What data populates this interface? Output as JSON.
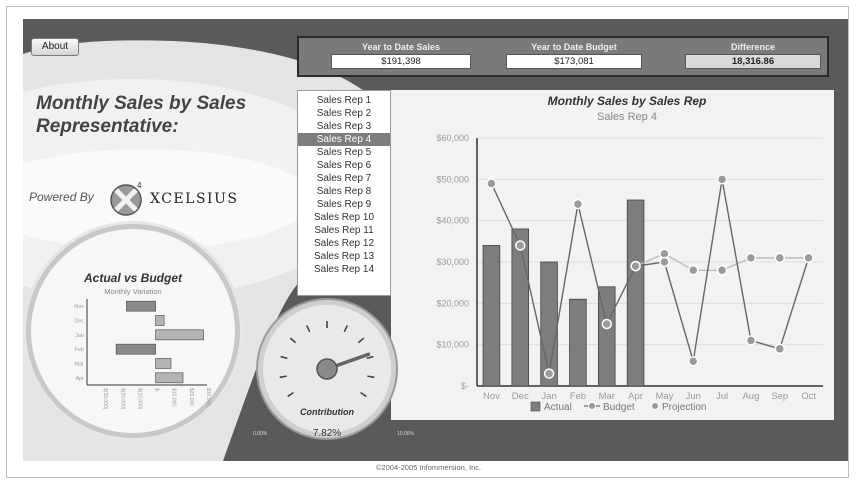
{
  "about_label": "About",
  "title": "Monthly Sales by Sales Representative:",
  "powered_by": "Powered By",
  "logo": {
    "superscript": "4",
    "text": "XCELSIUS",
    "icon": "xcelsius-logo-icon"
  },
  "kpis": [
    {
      "label": "Year to Date Sales",
      "value": "$191,398"
    },
    {
      "label": "Year to Date Budget",
      "value": "$173,081"
    },
    {
      "label": "Difference",
      "value": "18,316.86"
    }
  ],
  "reps": [
    "Sales Rep 1",
    "Sales Rep 2",
    "Sales Rep 3",
    "Sales Rep 4",
    "Sales Rep 5",
    "Sales Rep 6",
    "Sales Rep 7",
    "Sales Rep 8",
    "Sales Rep 9",
    "Sales Rep 10",
    "Sales Rep 11",
    "Sales Rep 12",
    "Sales Rep 13",
    "Sales Rep 14"
  ],
  "selected_rep": "Sales Rep 4",
  "avb": {
    "title": "Actual vs Budget",
    "subtitle": "Monthly Variation",
    "months": [
      "Nov",
      "Dec",
      "Jan",
      "Feb",
      "Mar",
      "Apr"
    ],
    "variation": [
      -17000,
      5000,
      28000,
      -23000,
      9000,
      16000
    ],
    "xlim": [
      -40000,
      30000
    ],
    "ticks": [
      "$(30,000)",
      "$(20,000)",
      "$(10,000)",
      "$-",
      "$10,000",
      "$20,000",
      "$30,000"
    ]
  },
  "gauge": {
    "label": "Contribution",
    "value": "7.82%",
    "min_label": "0.00%",
    "max_label": "10.00%",
    "fraction": 0.782
  },
  "footer": "©2004-2005 Infommersion, Inc.",
  "chart_data": {
    "type": "bar",
    "title": "Monthly Sales by Sales Rep",
    "subtitle": "Sales Rep 4",
    "categories": [
      "Nov",
      "Dec",
      "Jan",
      "Feb",
      "Mar",
      "Apr",
      "May",
      "Jun",
      "Jul",
      "Aug",
      "Sep",
      "Oct"
    ],
    "ylim": [
      0,
      60000
    ],
    "yticks": [
      "$-",
      "$10,000",
      "$20,000",
      "$30,000",
      "$40,000",
      "$50,000",
      "$60,000"
    ],
    "series": [
      {
        "name": "Actual",
        "type": "bar",
        "values": [
          34000,
          38000,
          30000,
          21000,
          24000,
          45000,
          null,
          null,
          null,
          null,
          null,
          null
        ]
      },
      {
        "name": "Budget",
        "type": "line",
        "values": [
          49000,
          34000,
          3000,
          44000,
          15000,
          29000,
          30000,
          6000,
          50000,
          11000,
          9000,
          31000
        ]
      },
      {
        "name": "Projection",
        "type": "line",
        "values": [
          null,
          null,
          null,
          null,
          null,
          29000,
          32000,
          28000,
          28000,
          31000,
          31000,
          31000
        ]
      }
    ],
    "legend_position": "bottom",
    "grid": true
  },
  "colors": {
    "bar": "#7d7d7d",
    "line": "#666666",
    "marker": "#9a9a9a",
    "projection": "#bcbcbc"
  }
}
